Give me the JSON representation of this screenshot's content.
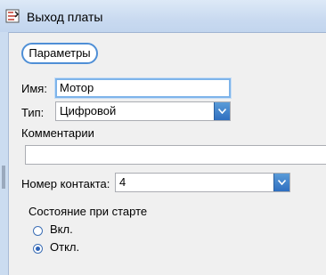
{
  "window": {
    "title": "Выход платы",
    "icon": "board-output-icon"
  },
  "toolbar": {
    "params_label": "Параметры"
  },
  "form": {
    "name_label": "Имя:",
    "name_value": "Мотор",
    "type_label": "Тип:",
    "type_value": "Цифровой",
    "comments_label": "Комментарии",
    "comments_value": "",
    "contact_label": "Номер контакта:",
    "contact_value": "4",
    "startup_state_label": "Состояние при старте",
    "startup_options": [
      {
        "label": "Вкл.",
        "selected": false
      },
      {
        "label": "Откл.",
        "selected": true
      }
    ]
  },
  "colors": {
    "accent": "#4f8fd6",
    "focus": "#7eb4ea",
    "radio_dot": "#2d63b8"
  }
}
